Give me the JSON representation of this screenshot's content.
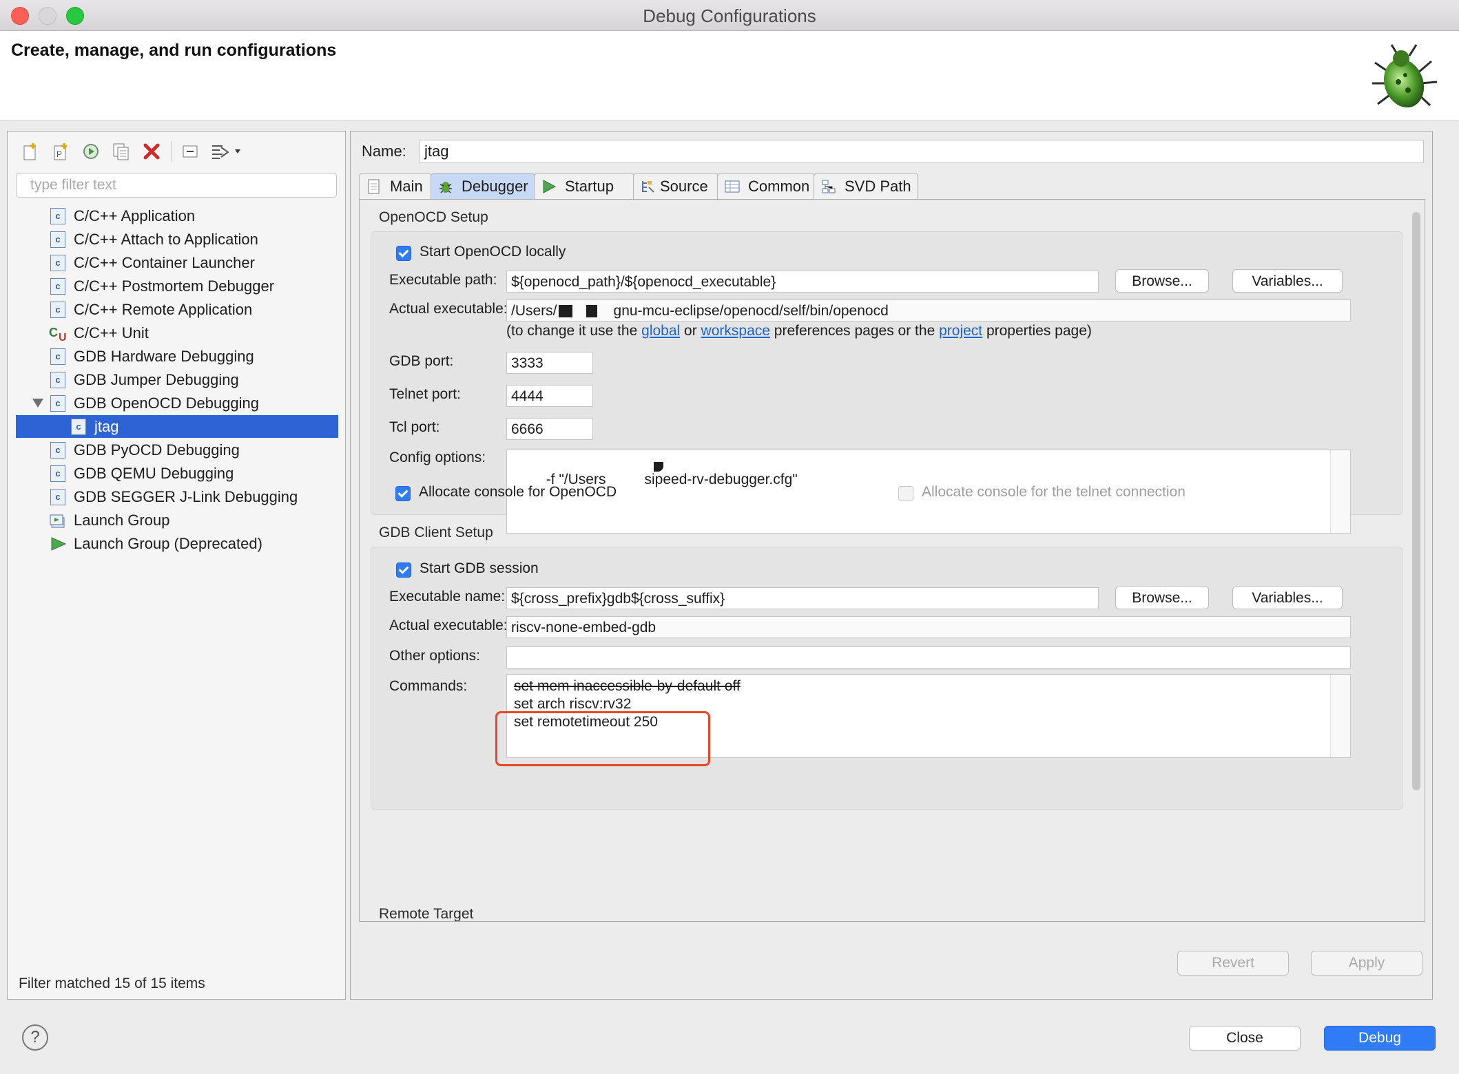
{
  "window": {
    "title": "Debug Configurations",
    "header": "Create, manage, and run configurations"
  },
  "sidebar": {
    "filter_placeholder": "type filter text",
    "status": "Filter matched 15 of 15 items",
    "items": [
      {
        "label": "C/C++ Application",
        "icon": "c-config-icon"
      },
      {
        "label": "C/C++ Attach to Application",
        "icon": "c-config-icon"
      },
      {
        "label": "C/C++ Container Launcher",
        "icon": "c-config-icon"
      },
      {
        "label": "C/C++ Postmortem Debugger",
        "icon": "c-config-icon"
      },
      {
        "label": "C/C++ Remote Application",
        "icon": "c-config-icon"
      },
      {
        "label": "C/C++ Unit",
        "icon": "cu-unit-icon"
      },
      {
        "label": "GDB Hardware Debugging",
        "icon": "c-config-icon"
      },
      {
        "label": "GDB Jumper Debugging",
        "icon": "c-config-icon"
      },
      {
        "label": "GDB OpenOCD Debugging",
        "icon": "c-config-icon",
        "expanded": true
      },
      {
        "label": "jtag",
        "icon": "c-config-icon",
        "selected": true,
        "child": true
      },
      {
        "label": "GDB PyOCD Debugging",
        "icon": "c-config-icon"
      },
      {
        "label": "GDB QEMU Debugging",
        "icon": "c-config-icon"
      },
      {
        "label": "GDB SEGGER J-Link Debugging",
        "icon": "c-config-icon"
      },
      {
        "label": "Launch Group",
        "icon": "launch-group-icon"
      },
      {
        "label": "Launch Group (Deprecated)",
        "icon": "run-arrow-icon"
      }
    ]
  },
  "config": {
    "name_label": "Name:",
    "name_value": "jtag",
    "tabs": [
      "Main",
      "Debugger",
      "Startup",
      "Source",
      "Common",
      "SVD Path"
    ],
    "active_tab": "Debugger"
  },
  "openocd": {
    "section": "OpenOCD Setup",
    "start_locally": "Start OpenOCD locally",
    "exec_path_label": "Executable path:",
    "exec_path_value": "${openocd_path}/${openocd_executable}",
    "actual_exec_label": "Actual executable:",
    "actual_exec_prefix": "/Users/",
    "actual_exec_suffix": "gnu-mcu-eclipse/openocd/self/bin/openocd",
    "hint_prefix": "(to change it use the ",
    "hint_link1": "global",
    "hint_or": " or ",
    "hint_link2": "workspace",
    "hint_middle": " preferences pages or the ",
    "hint_link3": "project",
    "hint_suffix": " properties page)",
    "gdb_port_label": "GDB port:",
    "gdb_port_value": "3333",
    "telnet_port_label": "Telnet port:",
    "telnet_port_value": "4444",
    "tcl_port_label": "Tcl port:",
    "tcl_port_value": "6666",
    "config_label": "Config options:",
    "config_prefix": "-f \"/Users",
    "config_suffix": "sipeed-rv-debugger.cfg\"",
    "alloc_console": "Allocate console for OpenOCD",
    "alloc_telnet": "Allocate console for the telnet connection"
  },
  "gdb": {
    "section": "GDB Client Setup",
    "start_session": "Start GDB session",
    "exec_name_label": "Executable name:",
    "exec_name_value": "${cross_prefix}gdb${cross_suffix}",
    "actual_exec_label": "Actual executable:",
    "actual_exec_value": "riscv-none-embed-gdb",
    "other_label": "Other options:",
    "other_value": "",
    "commands_label": "Commands:",
    "commands": [
      "set mem inaccessible-by-default off",
      "set arch riscv:rv32",
      "set remotetimeout 250"
    ]
  },
  "remote_target": "Remote Target",
  "buttons": {
    "browse": "Browse...",
    "variables": "Variables...",
    "revert": "Revert",
    "apply": "Apply",
    "close": "Close",
    "debug": "Debug",
    "help": "?"
  },
  "colors": {
    "accent": "#2f7cf6",
    "selection": "#2d63d5",
    "highlight_box": "#e5472b",
    "link": "#1b63d2"
  }
}
